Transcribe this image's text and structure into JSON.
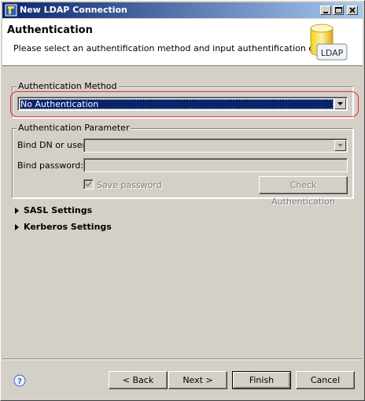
{
  "window": {
    "title": "New LDAP Connection"
  },
  "banner": {
    "heading": "Authentication",
    "description": "Please select an authentification method and input authentification data.",
    "icon_text": "LDAP"
  },
  "auth_method": {
    "group_label": "Authentication Method",
    "selected": "No Authentication"
  },
  "auth_param": {
    "group_label": "Authentication Parameter",
    "bind_dn_label": "Bind DN or user:",
    "bind_dn_value": "",
    "bind_password_label": "Bind password:",
    "bind_password_value": "",
    "save_password_label": "Save password",
    "save_password_checked": true,
    "check_button": "Check Authentication"
  },
  "sections": {
    "sasl": "SASL Settings",
    "kerberos": "Kerberos Settings"
  },
  "footer": {
    "back": "< Back",
    "next": "Next >",
    "finish": "Finish",
    "cancel": "Cancel"
  },
  "colors": {
    "accent": "#0a246a",
    "highlight_ring": "#e03030"
  },
  "icons": [
    "app-icon",
    "minimize-icon",
    "maximize-icon",
    "close-icon",
    "ldap-database-icon",
    "dropdown-arrow-icon",
    "checkmark-icon",
    "expand-triangle-icon",
    "help-icon"
  ]
}
